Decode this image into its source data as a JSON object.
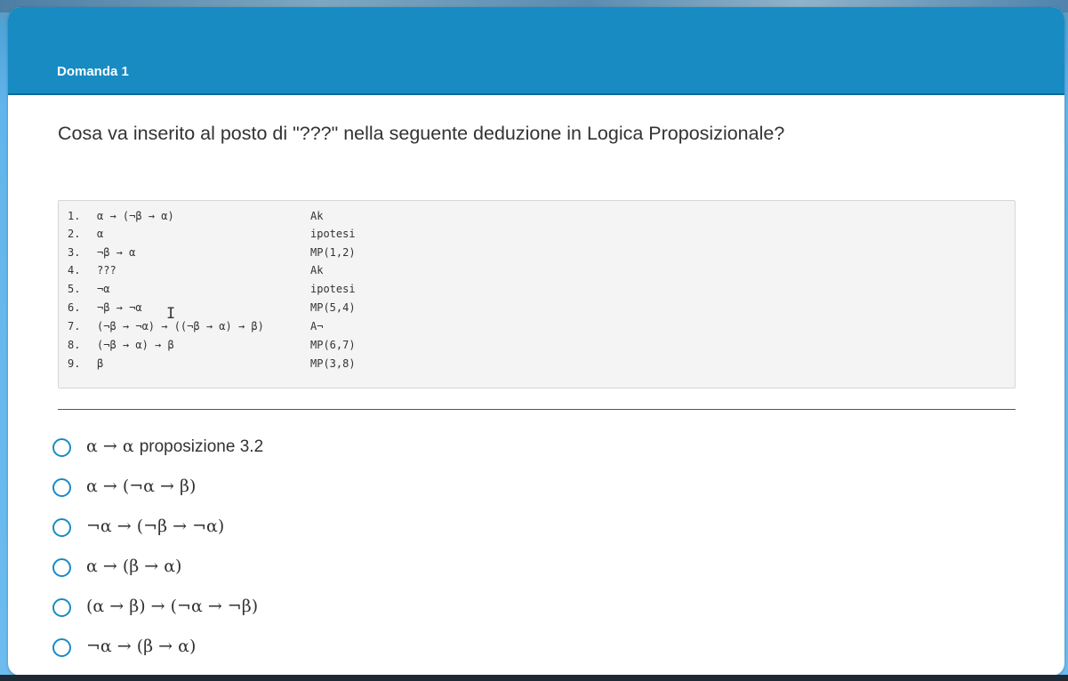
{
  "question": {
    "number_label": "Domanda 1",
    "text": "Cosa va inserito al posto di \"???\" nella seguente deduzione in Logica Proposizionale?"
  },
  "deduction": [
    {
      "num": "1.",
      "formula": "α → (¬β → α)",
      "rule": "Ak"
    },
    {
      "num": "2.",
      "formula": "α",
      "rule": "ipotesi"
    },
    {
      "num": "3.",
      "formula": "¬β → α",
      "rule": "MP(1,2)"
    },
    {
      "num": "4.",
      "formula": "???",
      "rule": "Ak"
    },
    {
      "num": "5.",
      "formula": "¬α",
      "rule": "ipotesi"
    },
    {
      "num": "6.",
      "formula": "¬β → ¬α",
      "rule": "MP(5,4)"
    },
    {
      "num": "7.",
      "formula": "(¬β → ¬α) → ((¬β → α) → β)",
      "rule": "A¬"
    },
    {
      "num": "8.",
      "formula": "(¬β → α) → β",
      "rule": "MP(6,7)"
    },
    {
      "num": "9.",
      "formula": "β",
      "rule": "MP(3,8)"
    }
  ],
  "cursor_glyph": "I",
  "options": [
    {
      "formula": "α → α ",
      "suffix": "proposizione 3.2"
    },
    {
      "formula": "α → (¬α → β)",
      "suffix": ""
    },
    {
      "formula": "¬α → (¬β → ¬α)",
      "suffix": ""
    },
    {
      "formula": "α → (β → α)",
      "suffix": ""
    },
    {
      "formula": "(α → β) → (¬α → ¬β)",
      "suffix": ""
    },
    {
      "formula": "¬α → (β → α)",
      "suffix": ""
    }
  ],
  "colors": {
    "header": "#188bc3",
    "radio_border": "#188bc3",
    "code_background": "#f4f4f4"
  }
}
